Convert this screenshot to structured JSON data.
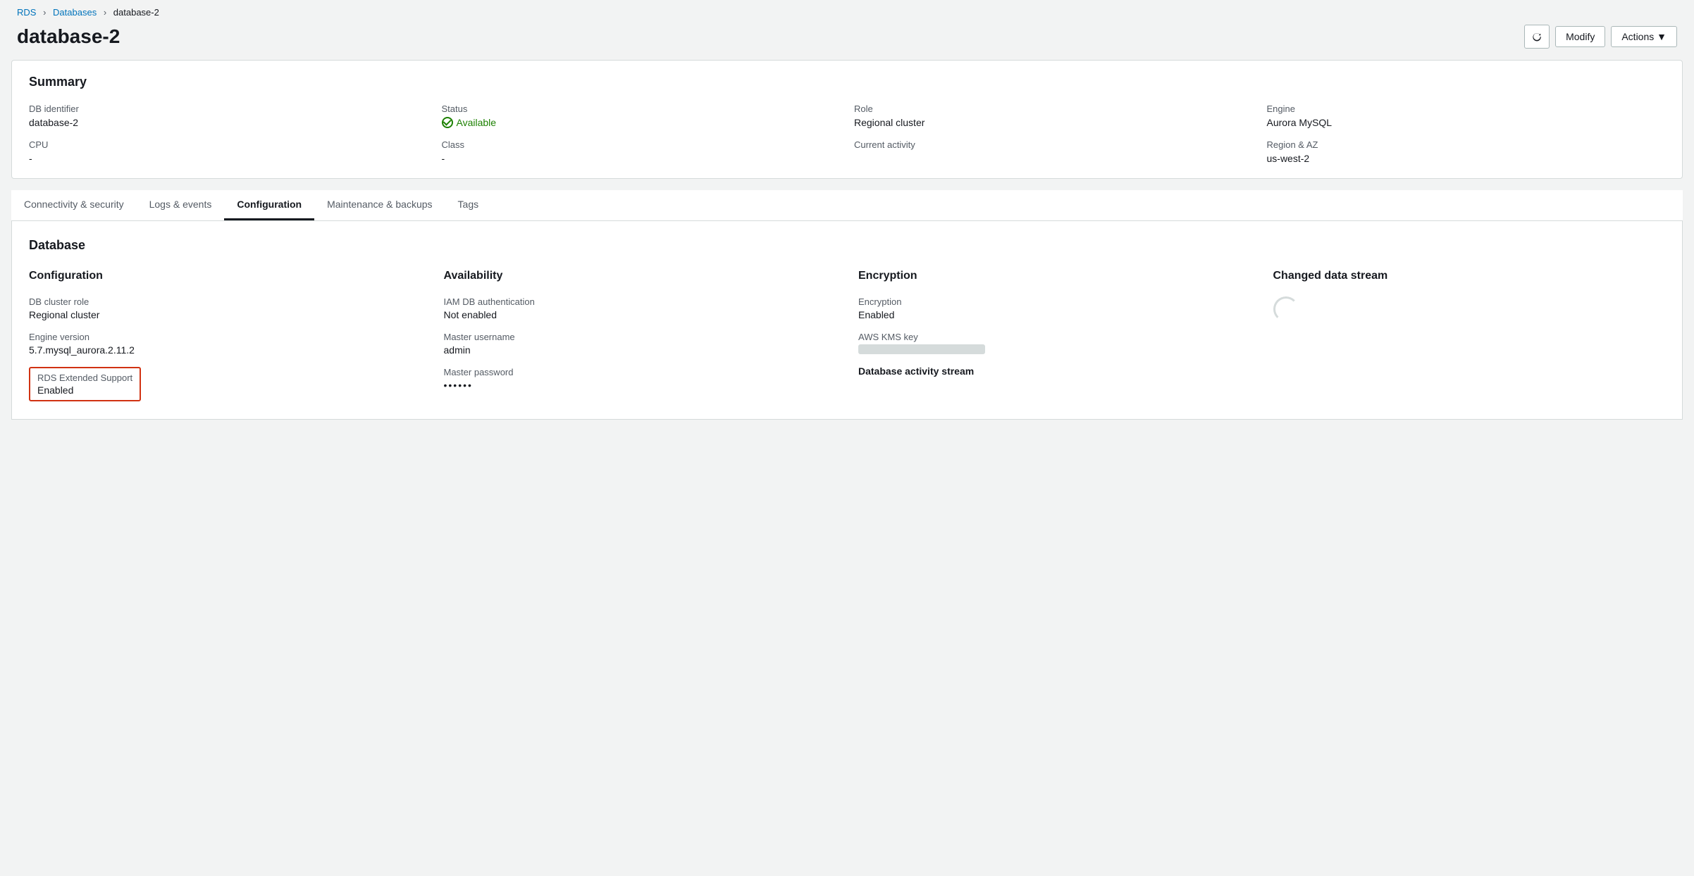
{
  "breadcrumb": {
    "rds": "RDS",
    "databases": "Databases",
    "current": "database-2"
  },
  "header": {
    "title": "database-2",
    "refresh_label": "↻",
    "modify_label": "Modify",
    "actions_label": "Actions ▼"
  },
  "summary": {
    "section_title": "Summary",
    "db_identifier_label": "DB identifier",
    "db_identifier_value": "database-2",
    "cpu_label": "CPU",
    "cpu_value": "-",
    "status_label": "Status",
    "status_value": "Available",
    "class_label": "Class",
    "class_value": "-",
    "role_label": "Role",
    "role_value": "Regional cluster",
    "current_activity_label": "Current activity",
    "current_activity_value": "",
    "engine_label": "Engine",
    "engine_value": "Aurora MySQL",
    "region_az_label": "Region & AZ",
    "region_az_value": "us-west-2"
  },
  "tabs": [
    {
      "id": "connectivity",
      "label": "Connectivity & security",
      "active": false
    },
    {
      "id": "logs",
      "label": "Logs & events",
      "active": false
    },
    {
      "id": "configuration",
      "label": "Configuration",
      "active": true
    },
    {
      "id": "maintenance",
      "label": "Maintenance & backups",
      "active": false
    },
    {
      "id": "tags",
      "label": "Tags",
      "active": false
    }
  ],
  "database_section": {
    "title": "Database",
    "configuration": {
      "header": "Configuration",
      "db_cluster_role_label": "DB cluster role",
      "db_cluster_role_value": "Regional cluster",
      "engine_version_label": "Engine version",
      "engine_version_value": "5.7.mysql_aurora.2.11.2",
      "rds_extended_support_label": "RDS Extended Support",
      "rds_extended_support_value": "Enabled"
    },
    "availability": {
      "header": "Availability",
      "iam_db_label": "IAM DB authentication",
      "iam_db_value": "Not enabled",
      "master_username_label": "Master username",
      "master_username_value": "admin",
      "master_password_label": "Master password",
      "master_password_value": "••••••"
    },
    "encryption": {
      "header": "Encryption",
      "encryption_label": "Encryption",
      "encryption_value": "Enabled",
      "aws_kms_label": "AWS KMS key",
      "database_activity_label": "Database activity stream"
    },
    "changed_data_stream": {
      "header": "Changed data stream"
    }
  }
}
